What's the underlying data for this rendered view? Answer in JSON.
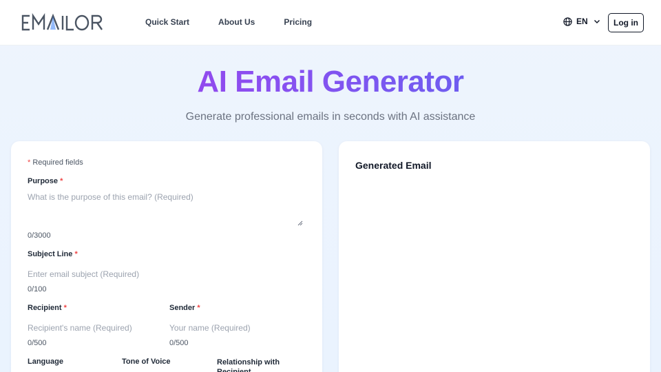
{
  "header": {
    "logo_text": "EMAILOR",
    "nav": [
      "Quick Start",
      "About Us",
      "Pricing"
    ],
    "language_code": "EN",
    "login_label": "Log in"
  },
  "hero": {
    "title": "AI Email Generator",
    "subtitle": "Generate professional emails in seconds with AI assistance"
  },
  "form": {
    "required_note": "Required fields",
    "purpose": {
      "label": "Purpose",
      "placeholder": "What is the purpose of this email? (Required)",
      "counter": "0/3000"
    },
    "subject": {
      "label": "Subject Line",
      "placeholder": "Enter email subject (Required)",
      "counter": "0/100"
    },
    "recipient": {
      "label": "Recipient",
      "placeholder": "Recipient's name (Required)",
      "counter": "0/500"
    },
    "sender": {
      "label": "Sender",
      "placeholder": "Your name (Required)",
      "counter": "0/500"
    },
    "language_label": "Language",
    "tone_label": "Tone of Voice",
    "relationship_label": "Relationship with Recipient",
    "required_marker": "*"
  },
  "output": {
    "title": "Generated Email"
  },
  "colors": {
    "accent_start": "#a33be8",
    "accent_end": "#4f7df2",
    "required_star": "#ef4444",
    "background": "#eef4fd"
  }
}
